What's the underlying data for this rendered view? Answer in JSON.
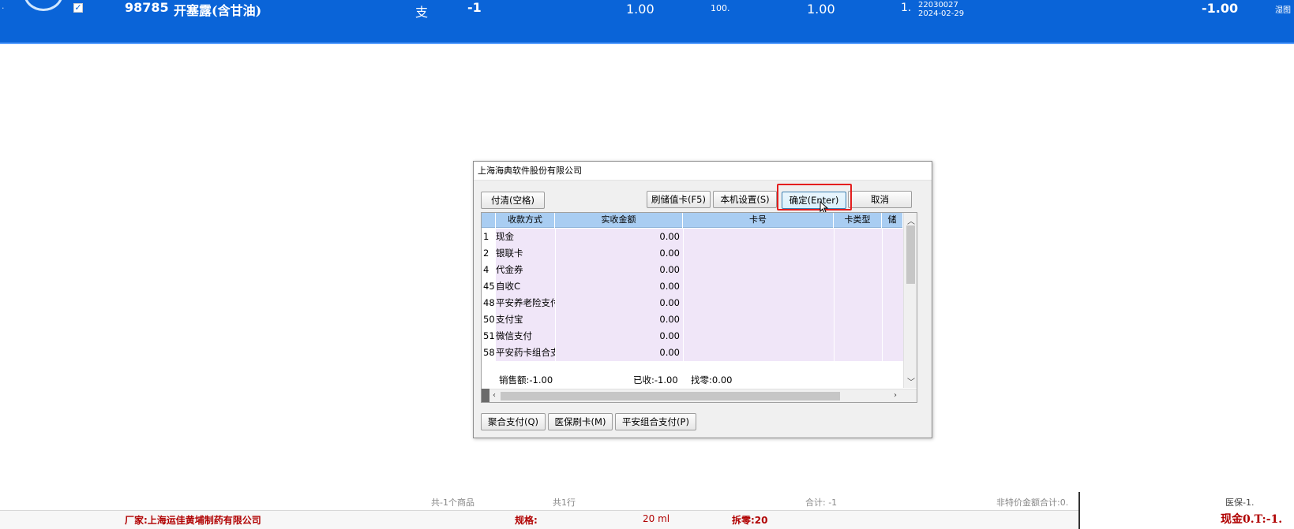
{
  "top_row": {
    "code": "98785",
    "name": "开塞露(含甘油)",
    "unit": "支",
    "qty": "-1",
    "price1": "1.00",
    "price2": "100.",
    "price3": "1.00",
    "price4": "1.",
    "batch": "22030027",
    "expiry": "2024-02-29",
    "total": "-1.00",
    "cut_text": "湿图"
  },
  "dialog": {
    "title": "上海海典软件股份有限公司",
    "buttons": {
      "clear": "付清(空格)",
      "stored_card": "刷储值卡(F5)",
      "settings": "本机设置(S)",
      "confirm": "确定(Enter)",
      "cancel": "取消",
      "aggregate": "聚合支付(Q)",
      "medical_card": "医保刷卡(M)",
      "pingan_combo": "平安组合支付(P)"
    },
    "columns": [
      "收款方式",
      "实收金额",
      "卡号",
      "卡类型",
      "储"
    ],
    "rows": [
      {
        "no": "1",
        "type": "现金",
        "amount": "0.00"
      },
      {
        "no": "2",
        "type": "银联卡",
        "amount": "0.00"
      },
      {
        "no": "4",
        "type": "代金券",
        "amount": "0.00"
      },
      {
        "no": "45",
        "type": "自收C",
        "amount": "0.00"
      },
      {
        "no": "48",
        "type": "平安养老险支付",
        "amount": "0.00"
      },
      {
        "no": "50",
        "type": "支付宝",
        "amount": "0.00"
      },
      {
        "no": "51",
        "type": "微信支付",
        "amount": "0.00"
      },
      {
        "no": "58",
        "type": "平安药卡组合支",
        "amount": "0.00"
      }
    ],
    "summary": {
      "sales": "销售额:-1.00",
      "received": "已收:-1.00",
      "change": "找零:0.00"
    }
  },
  "footer": {
    "item_count": "共-1个商品",
    "row_count": "共1行",
    "total": "合计: -1",
    "non_special": "非特价金额合计:0.",
    "medical": "医保-1.",
    "manufacturer": "厂家:上海运佳黄埔制药有限公司",
    "spec_label": "规格:",
    "spec_value": "20 ml",
    "discount": "拆零:20",
    "cash": "现金0.T:-1."
  }
}
